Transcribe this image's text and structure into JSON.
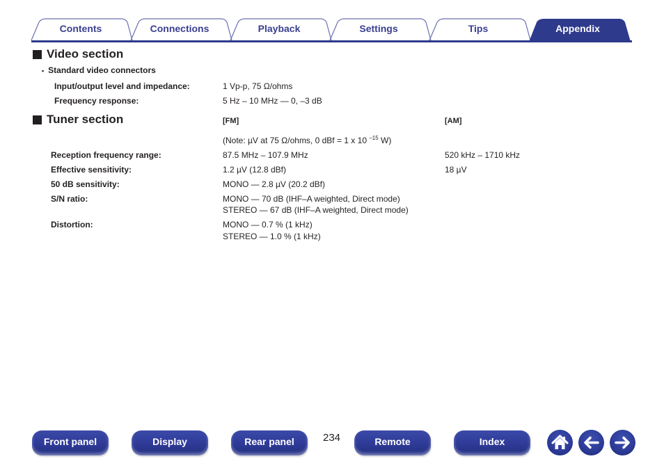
{
  "tabs": [
    {
      "label": "Contents",
      "active": false
    },
    {
      "label": "Connections",
      "active": false
    },
    {
      "label": "Playback",
      "active": false
    },
    {
      "label": "Settings",
      "active": false
    },
    {
      "label": "Tips",
      "active": false
    },
    {
      "label": "Appendix",
      "active": true
    }
  ],
  "colors": {
    "tab_text": "#3a3f8f",
    "tab_outline": "#6a6fb0",
    "tab_active_fill": "#2e3a8c",
    "rule": "#2e3a8c",
    "button_fill": "#2e3a96",
    "body_text": "#231f20"
  },
  "video_section": {
    "title": "Video section",
    "subhead": "Standard video connectors",
    "rows": [
      {
        "label": "Input/output level and impedance:",
        "value": "1 Vp-p, 75 Ω/ohms"
      },
      {
        "label": "Frequency response:",
        "value": "5 Hz – 10 MHz — 0, –3 dB"
      }
    ]
  },
  "tuner_section": {
    "title": "Tuner section",
    "fm_header": "[FM]",
    "am_header": "[AM]",
    "note_prefix": "(Note: µV at 75 Ω/ohms, 0 dBf = 1 x 10 ",
    "note_exp": "–15",
    "note_suffix": " W)",
    "rows": [
      {
        "label": "Reception frequency range:",
        "fm": [
          "87.5 MHz – 107.9 MHz"
        ],
        "am": "520 kHz – 1710 kHz"
      },
      {
        "label": "Effective sensitivity:",
        "fm": [
          "1.2 µV (12.8 dBf)"
        ],
        "am": "18 µV"
      },
      {
        "label": "50 dB sensitivity:",
        "fm": [
          "MONO — 2.8 µV (20.2 dBf)"
        ],
        "am": ""
      },
      {
        "label": "S/N ratio:",
        "fm": [
          "MONO — 70 dB (IHF–A weighted, Direct mode)",
          "STEREO — 67 dB (IHF–A weighted, Direct mode)"
        ],
        "am": ""
      },
      {
        "label": "Distortion:",
        "fm": [
          "MONO — 0.7 % (1 kHz)",
          "STEREO — 1.0 % (1 kHz)"
        ],
        "am": ""
      }
    ]
  },
  "footer": {
    "buttons": [
      "Front panel",
      "Display",
      "Rear panel",
      "Remote",
      "Index"
    ],
    "page_number": "234",
    "icons": [
      "home-icon",
      "back-arrow-icon",
      "forward-arrow-icon"
    ]
  }
}
